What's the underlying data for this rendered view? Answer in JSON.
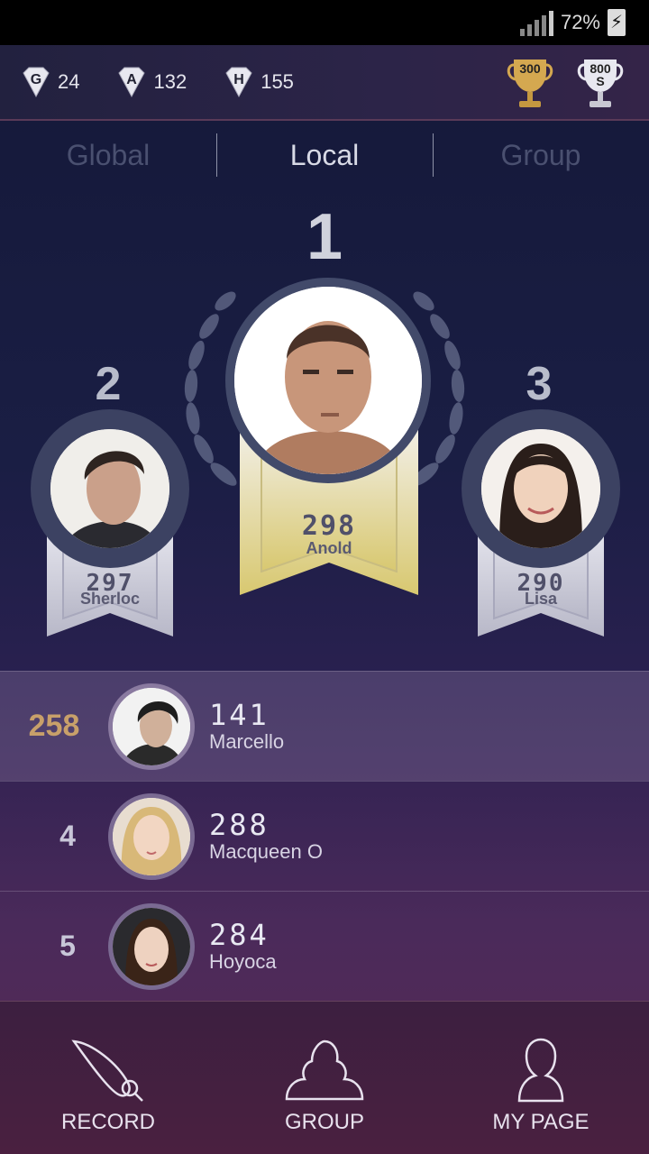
{
  "status": {
    "battery": "72%"
  },
  "stats": [
    {
      "letter": "G",
      "value": "24"
    },
    {
      "letter": "A",
      "value": "132"
    },
    {
      "letter": "H",
      "value": "155"
    }
  ],
  "trophies": [
    {
      "label": "300",
      "label2": "",
      "color": "#d4a850"
    },
    {
      "label": "800",
      "label2": "S",
      "color": "#e6e6ee"
    }
  ],
  "tabs": [
    "Global",
    "Local",
    "Group"
  ],
  "podium": {
    "first": {
      "rank": "1",
      "score": "298",
      "name": "Anold"
    },
    "second": {
      "rank": "2",
      "score": "297",
      "name": "Sherloc"
    },
    "third": {
      "rank": "3",
      "score": "290",
      "name": "Lisa"
    }
  },
  "list": [
    {
      "rank": "258",
      "score": "141",
      "name": "Marcello",
      "me": true
    },
    {
      "rank": "4",
      "score": "288",
      "name": "Macqueen O",
      "me": false
    },
    {
      "rank": "5",
      "score": "284",
      "name": "Hoyoca",
      "me": false
    }
  ],
  "nav": [
    {
      "label": "RECORD",
      "icon": "brush-icon"
    },
    {
      "label": "GROUP",
      "icon": "group-icon"
    },
    {
      "label": "MY PAGE",
      "icon": "person-icon"
    }
  ]
}
